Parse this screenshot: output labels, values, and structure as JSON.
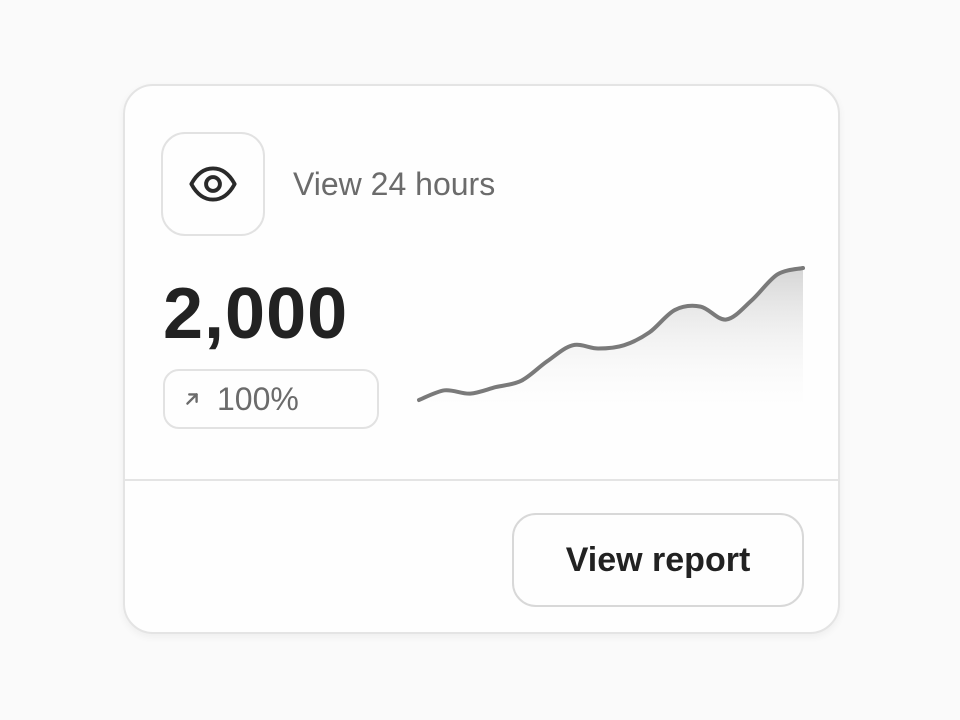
{
  "card": {
    "icon": "eye-icon",
    "period_label": "View 24 hours",
    "metric_value": "2,000",
    "change": {
      "icon": "arrow-up-right-icon",
      "value": "100%"
    },
    "sparkline": {
      "type": "area",
      "values": [
        38,
        41,
        40,
        42,
        44,
        50,
        55,
        54,
        55,
        59,
        66,
        67,
        63,
        69,
        77,
        79
      ]
    },
    "button_label": "View report"
  },
  "colors": {
    "background": "#fafafa",
    "card": "#fefefe",
    "border": "#e4e4e4",
    "text_primary": "#222222",
    "text_secondary": "#6b6b6b",
    "line": "#7a7a7a"
  }
}
